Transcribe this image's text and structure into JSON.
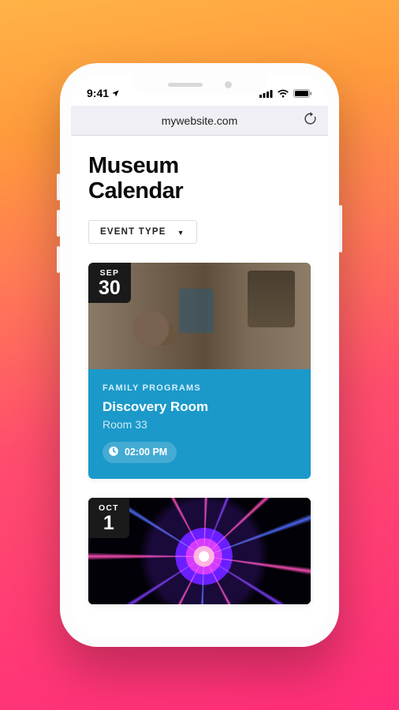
{
  "status": {
    "time": "9:41"
  },
  "browser": {
    "url": "mywebsite.com"
  },
  "page": {
    "title_line1": "Museum",
    "title_line2": "Calendar",
    "filter_label": "EVENT TYPE"
  },
  "events": [
    {
      "date_month": "SEP",
      "date_day": "30",
      "category": "FAMILY PROGRAMS",
      "title": "Discovery Room",
      "room": "Room 33",
      "time": "02:00 PM"
    },
    {
      "date_month": "OCT",
      "date_day": "1"
    }
  ]
}
